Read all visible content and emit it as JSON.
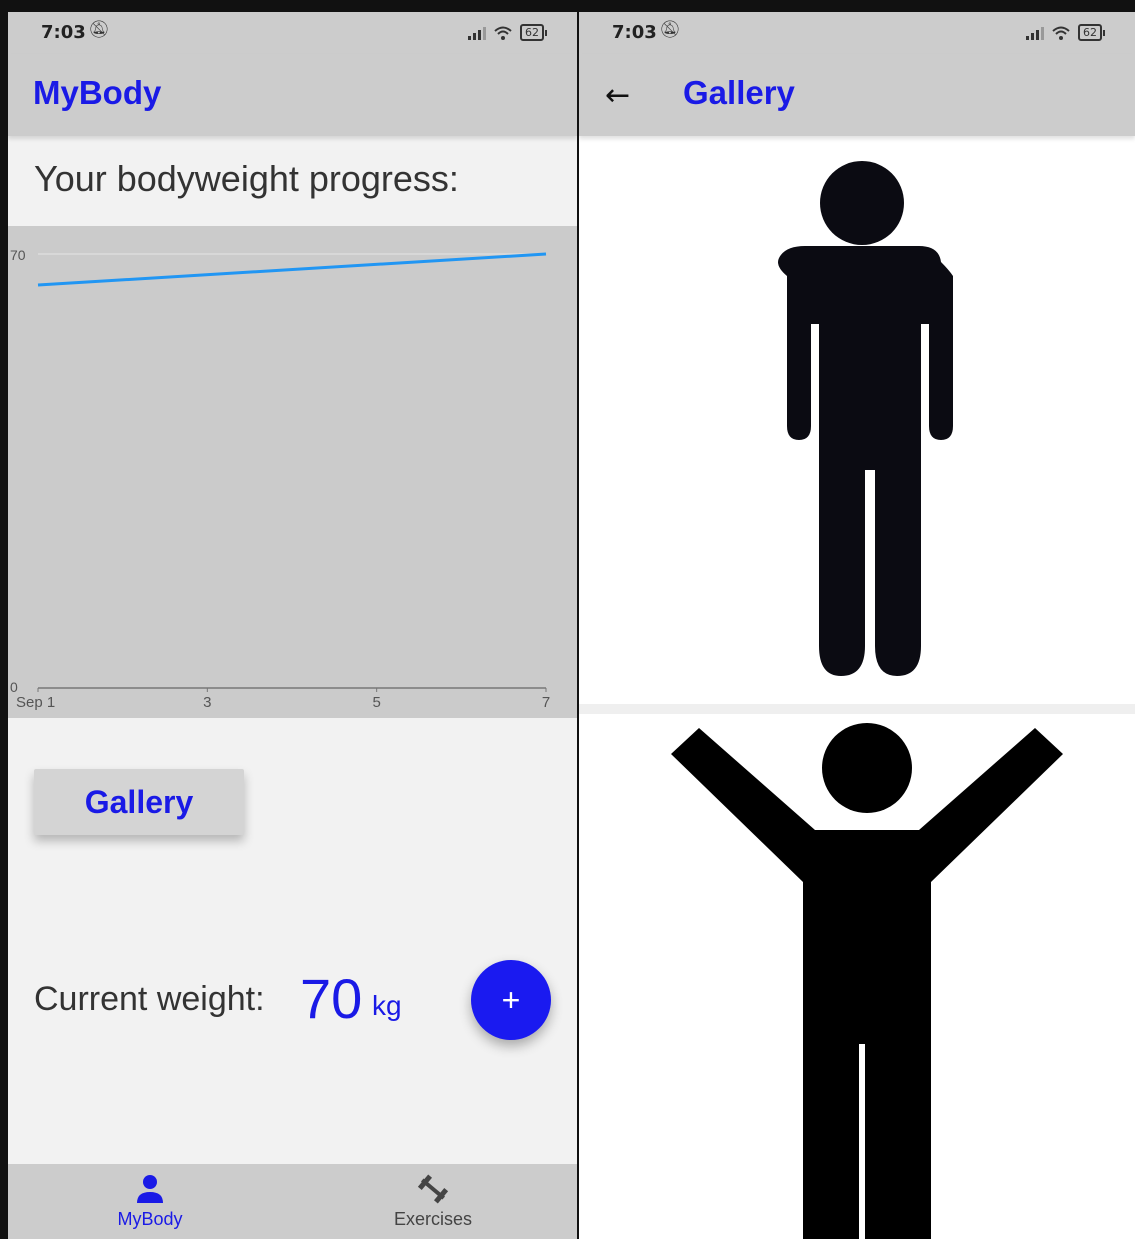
{
  "left_screen": {
    "status_bar": {
      "time": "7:03",
      "battery": "62"
    },
    "app_bar": {
      "title": "MyBody"
    },
    "heading": "Your bodyweight progress:",
    "gallery_button": "Gallery",
    "current_weight": {
      "label": "Current weight:",
      "value": "70",
      "unit": "kg"
    },
    "fab_label": "+",
    "bottom_nav": [
      {
        "label": "MyBody",
        "icon": "person-icon",
        "active": true
      },
      {
        "label": "Exercises",
        "icon": "dumbbell-icon",
        "active": false
      }
    ]
  },
  "right_screen": {
    "status_bar": {
      "time": "7:03",
      "battery": "62"
    },
    "app_bar": {
      "title": "Gallery",
      "back_icon": "arrow-left-icon"
    },
    "photos": [
      {
        "icon": "standing-person-icon"
      },
      {
        "icon": "person-arms-raised-icon"
      }
    ]
  },
  "colors": {
    "accent": "#1a1ae6",
    "line": "#2196f3",
    "bar": "#cccccc",
    "chart_bg": "#cbcbcb"
  },
  "chart_data": {
    "type": "line",
    "x_tick_labels": [
      "Sep 1",
      "3",
      "5",
      "7"
    ],
    "y_tick_labels": [
      "0",
      "70"
    ],
    "ylim": [
      0,
      70
    ],
    "xlim": [
      1,
      7
    ],
    "series": [
      {
        "x": [
          1,
          7
        ],
        "y": [
          65,
          70
        ]
      }
    ],
    "grid": true
  }
}
